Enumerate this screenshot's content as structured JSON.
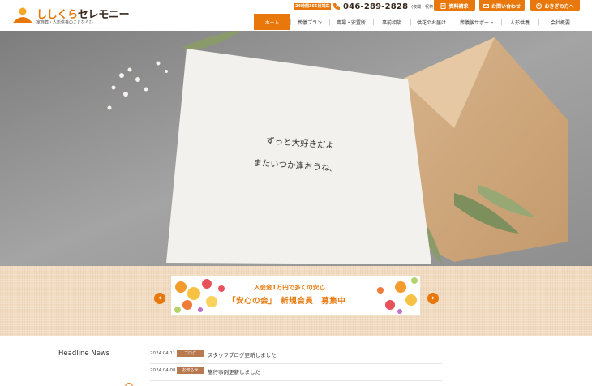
{
  "brand": {
    "name_main": "ししくら",
    "name_sub": "セレモニー",
    "tagline": "家族葬・人形供養のことならひ",
    "accent_color": "#e8780c"
  },
  "header": {
    "badge": "24時間365日対応",
    "phone_number": "046-289-2828",
    "phone_note": "(夜間・祝祭日OK)",
    "buttons": [
      {
        "label": "資料請求",
        "icon": "document-icon"
      },
      {
        "label": "お問い合わせ",
        "icon": "mail-icon"
      },
      {
        "label": "おきぎの方へ",
        "icon": "person-icon"
      }
    ]
  },
  "nav": {
    "items": [
      "ホーム",
      "葬儀プラン",
      "斎場・安置所",
      "事前相談",
      "供花のお届け",
      "葬儀後サポート",
      "人形供養",
      "会社概要"
    ],
    "active": "ホーム"
  },
  "hero": {
    "card_lines": [
      "ずっと大好きだよ",
      "またいつか逢おうね。"
    ]
  },
  "banner": {
    "line1": "入会金1万円で多くの安心",
    "line2": "「安心の会」　新規会員　募集中"
  },
  "news": {
    "title": "Headline News",
    "items": [
      {
        "date": "2024.04.11",
        "tag": "ブログ",
        "text": "スタッフブログ更新しました"
      },
      {
        "date": "2024.04.08",
        "tag": "お知らせ",
        "text": "施行事例更新しました"
      }
    ]
  }
}
